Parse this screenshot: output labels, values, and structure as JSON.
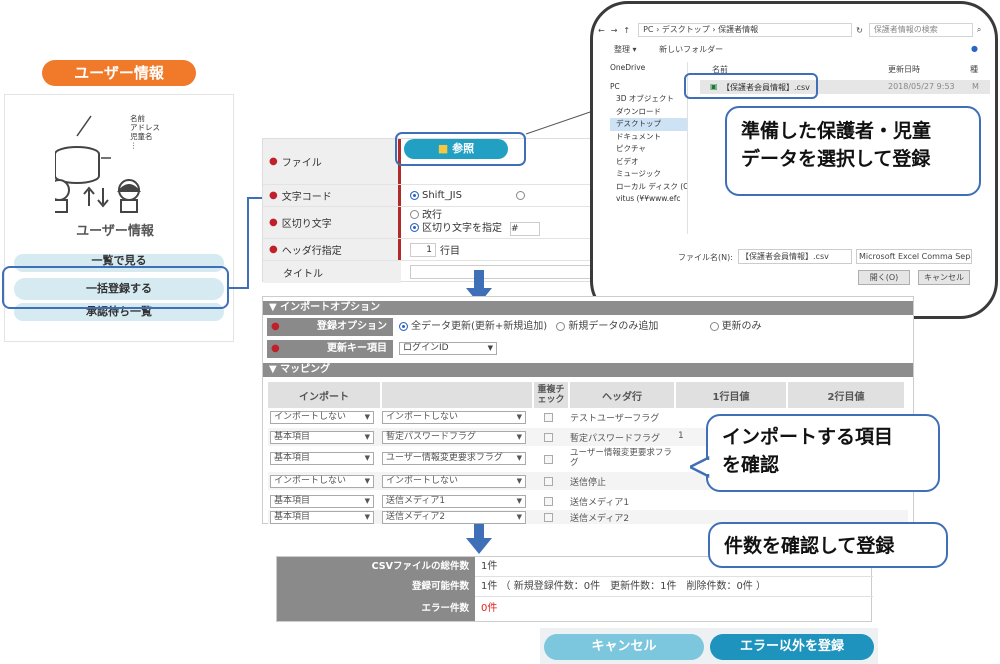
{
  "user_card": {
    "title": "ユーザー情報",
    "label": "ユーザー情報",
    "db_labels": [
      "名前",
      "アドレス",
      "児童名",
      "⋮"
    ],
    "menu": {
      "list": "一覧で見る",
      "bulk": "一括登録する",
      "pending": "承認待ち一覧"
    }
  },
  "file_form": {
    "file_label": "ファイル",
    "browse": "参照",
    "charset_label": "文字コード",
    "charset_value": "Shift_JIS",
    "delimiter_label": "区切り文字",
    "delimiter_opt1": "改行",
    "delimiter_opt2": "区切り文字を指定",
    "delimiter_input": "#",
    "header_label": "ヘッダ行指定",
    "header_value": "1",
    "header_unit": "行目",
    "title_label": "タイトル"
  },
  "explorer": {
    "path": "PC › デスクトップ › 保護者情報",
    "search": "保護者情報の検索",
    "organize": "整理 ▾",
    "new_folder": "新しいフォルダー",
    "nav": [
      "OneDrive",
      "PC",
      "3D オブジェクト",
      "ダウンロード",
      "デスクトップ",
      "ドキュメント",
      "ピクチャ",
      "ビデオ",
      "ミュージック",
      "ローカル ディスク (C",
      "vitus (¥¥www.efc"
    ],
    "col_name": "名前",
    "col_date": "更新日時",
    "col_type": "種",
    "file_name": "【保護者会員情報】.csv",
    "file_date": "2018/05/27 9:53",
    "file_type": "M",
    "filename_label": "ファイル名(N):",
    "filename_value": "【保護者会員情報】.csv",
    "filter": "Microsoft Excel Comma Separat",
    "open": "開く(O)",
    "cancel": "キャンセル"
  },
  "callouts": {
    "select_line1": "準備した保護者・児童",
    "select_line2": "データを選択して登録",
    "items_line1": "インポートする項目",
    "items_line2": "を確認",
    "count": "件数を確認して登録"
  },
  "import_options": {
    "section": "▼ インポートオプション",
    "reg_option_label": "登録オプション",
    "opt_all": "全データ更新(更新+新規追加)",
    "opt_new": "新規データのみ追加",
    "opt_update": "更新のみ",
    "key_label": "更新キー項目",
    "key_value": "ログインID"
  },
  "mapping": {
    "section": "▼ マッピング",
    "headers": [
      "インポート",
      "",
      "重複チェック",
      "ヘッダ行",
      "1行目値",
      "2行目値"
    ],
    "rows": [
      {
        "import": "インポートしない",
        "field": "インポートしない",
        "header": "テストユーザーフラグ",
        "v1": ""
      },
      {
        "import": "基本項目",
        "field": "暫定パスワードフラグ",
        "header": "暫定パスワードフラグ",
        "v1": "1"
      },
      {
        "import": "基本項目",
        "field": "ユーザー情報変更要求フラグ",
        "header": "ユーザー情報変更要求フラグ",
        "v1": ""
      },
      {
        "import": "インポートしない",
        "field": "インポートしない",
        "header": "送信停止",
        "v1": ""
      },
      {
        "import": "基本項目",
        "field": "送信メディア1",
        "header": "送信メディア1",
        "v1": ""
      },
      {
        "import": "基本項目",
        "field": "送信メディア2",
        "header": "送信メディア2",
        "v1": ""
      }
    ]
  },
  "summary": {
    "total_label": "CSVファイルの総件数",
    "total_value": "1件",
    "ok_label": "登録可能件数",
    "ok_value": "1件 （ 新規登録件数：0件　更新件数：1件　削除件数：0件 ）",
    "err_label": "エラー件数",
    "err_value": "0件"
  },
  "actions": {
    "cancel": "キャンセル",
    "register": "エラー以外を登録"
  },
  "colors": {
    "accent": "#3f6fb7",
    "orange": "#f07a2a",
    "button": "#1e93bd",
    "error": "#e02020"
  }
}
